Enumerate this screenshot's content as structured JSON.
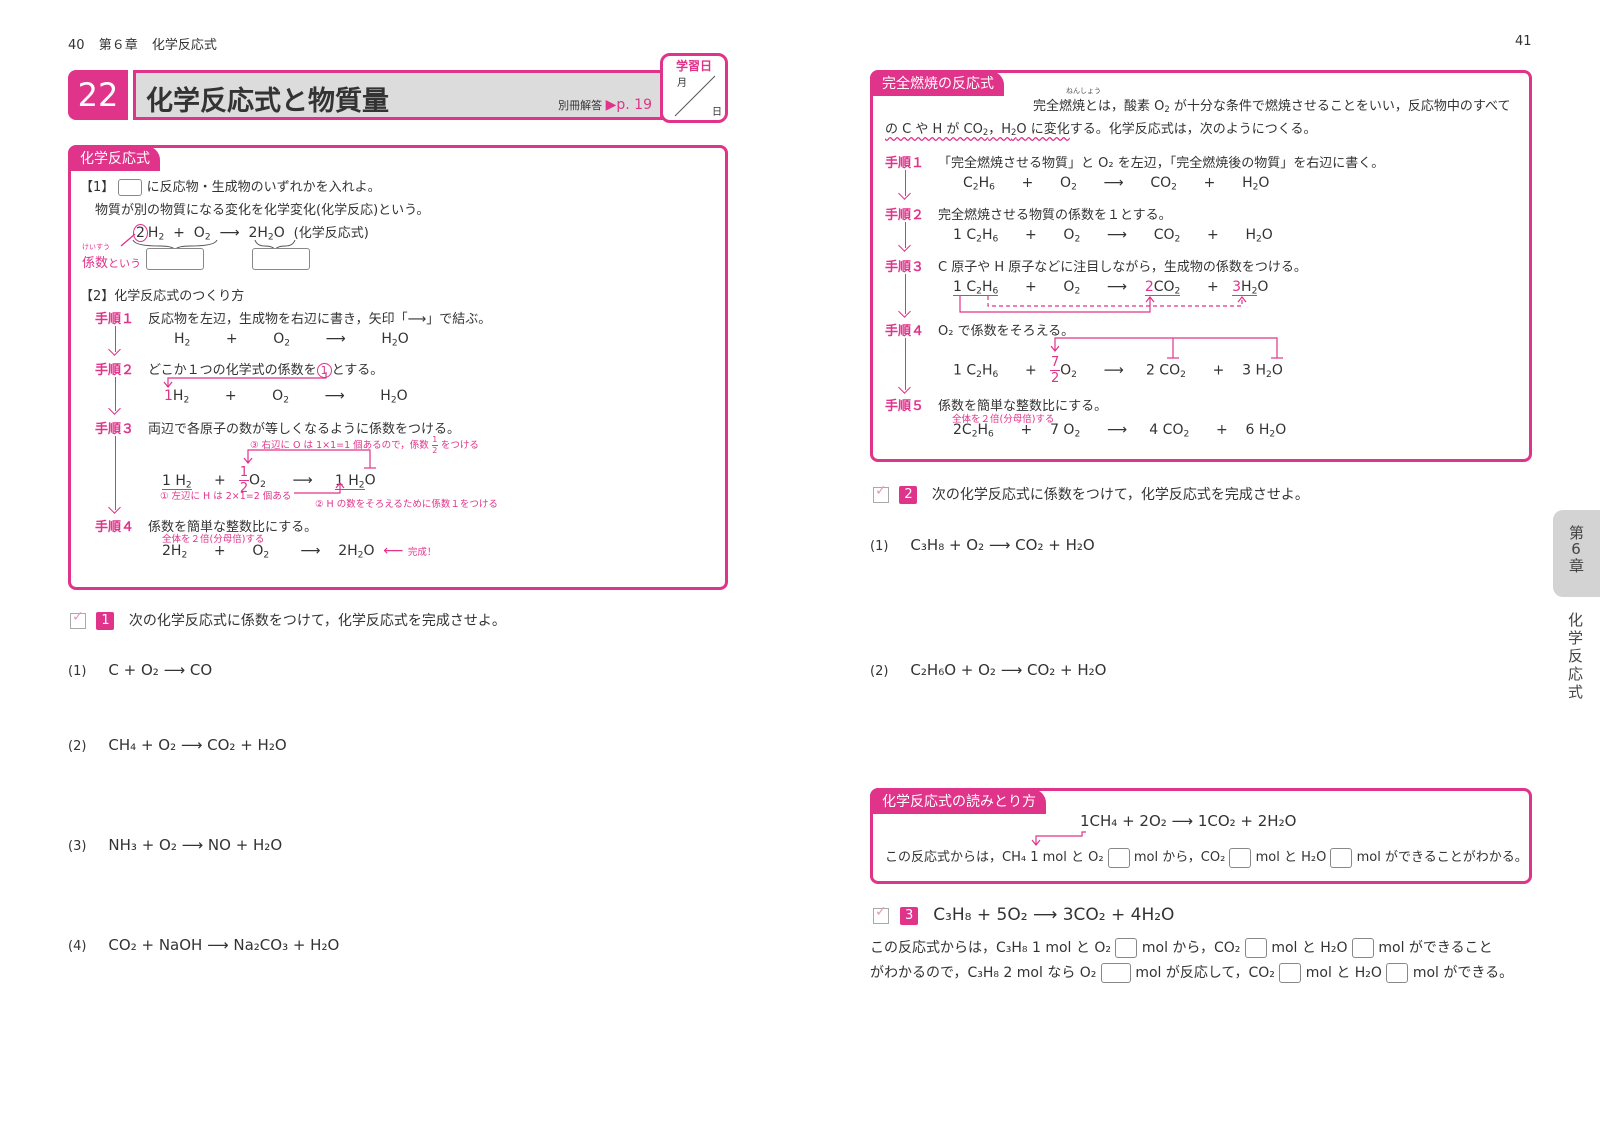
{
  "left_page": {
    "running_head": {
      "page_number": "40",
      "chapter": "第６章",
      "chapter_title": "化学反応式"
    },
    "lesson": {
      "number": "22",
      "title": "化学反応式と物質量",
      "answer_ref_label": "別冊解答",
      "answer_ref_page": "p. 19",
      "study_date": {
        "label": "学習日",
        "month": "月",
        "day": "日"
      }
    },
    "box": {
      "tag": "化学反応式",
      "q1": {
        "label": "【1】",
        "instruction": "に反応物・生成物のいずれかを入れよ。",
        "definition": "物質が別の物質になる変化を化学変化(化学反応)という。",
        "equation_note": "(化学反応式)",
        "coefficient_ruby": "けいすう",
        "coefficient_label": "係数",
        "coefficient_suffix": "という"
      },
      "q2": {
        "label": "【2】化学反応式のつくり方",
        "steps": [
          {
            "label": "手順１",
            "text": "反応物を左辺，生成物を右辺に書き，矢印「⟶」で結ぶ。"
          },
          {
            "label": "手順２",
            "text_pre": "どこか１つの化学式の係数を",
            "circled": "1",
            "text_post": "とする。"
          },
          {
            "label": "手順３",
            "text": "両辺で各原子の数が等しくなるように係数をつける。",
            "note3": "③ 右辺に O は 1×1=1 個あるので，係数",
            "note3_frac": {
              "num": "1",
              "den": "2"
            },
            "note3_post": "をつける",
            "note1": "① 左辺に H は 2×1=2 個ある",
            "note2": "② H の数をそろえるために係数１をつける"
          },
          {
            "label": "手順４",
            "text": "係数を簡単な整数比にする。",
            "note": "全体を２倍(分母倍)する",
            "done": "完成！"
          }
        ]
      }
    },
    "exercise1": {
      "number": "1",
      "instruction": "次の化学反応式に係数をつけて，化学反応式を完成させよ。",
      "items": [
        {
          "label": "(1)",
          "equation": "C + O₂ ⟶ CO"
        },
        {
          "label": "(2)",
          "equation": "CH₄ + O₂ ⟶ CO₂ + H₂O"
        },
        {
          "label": "(3)",
          "equation": "NH₃ + O₂ ⟶ NO + H₂O"
        },
        {
          "label": "(4)",
          "equation": "CO₂ + NaOH ⟶ Na₂CO₃ + H₂O"
        }
      ]
    }
  },
  "right_page": {
    "running_head": {
      "page_number": "41"
    },
    "combustion_box": {
      "tag": "完全燃焼の反応式",
      "ruby": "ねんしょう",
      "intro_line1_a": "完全燃焼とは，酸素 O",
      "intro_line1_b": "が十分な条件で燃焼させることをいい，反応物中のすべて",
      "intro_line2_a": "の C や H が CO",
      "intro_line2_b": "，H",
      "intro_line2_c": "O に変化",
      "intro_line2_d": "する。化学反応式は，次のようにつくる。",
      "steps": [
        {
          "label": "手順１",
          "text": "「完全燃焼させる物質」と O₂ を左辺，「完全燃焼後の物質」を右辺に書く。"
        },
        {
          "label": "手順２",
          "text": "完全燃焼させる物質の係数を１とする。"
        },
        {
          "label": "手順３",
          "text": "C 原子や H 原子などに注目しながら，生成物の係数をつける。"
        },
        {
          "label": "手順４",
          "text": "O₂ で係数をそろえる。",
          "frac": {
            "num": "7",
            "den": "2"
          }
        },
        {
          "label": "手順５",
          "text": "係数を簡単な整数比にする。",
          "note": "全体を２倍(分母倍)する"
        }
      ],
      "coef": {
        "s2": "1",
        "s3_a": "1",
        "s3_b": "2",
        "s3_c": "3",
        "s4_a": "1",
        "s4_b": "2",
        "s4_c": "3",
        "s5_a": "2",
        "s5_b": "7",
        "s5_c": "4",
        "s5_d": "6"
      }
    },
    "exercise2": {
      "number": "2",
      "instruction": "次の化学反応式に係数をつけて，化学反応式を完成させよ。",
      "items": [
        {
          "label": "(1)",
          "equation": "C₃H₈ + O₂ ⟶ CO₂ + H₂O"
        },
        {
          "label": "(2)",
          "equation": "C₂H₆O + O₂ ⟶ CO₂ + H₂O"
        }
      ]
    },
    "reading_box": {
      "tag": "化学反応式の読みとり方",
      "equation": "1CH₄ + 2O₂ ⟶ 1CO₂ + 2H₂O",
      "sentence_a": "この反応式からは，CH₄ 1 mol と O₂",
      "sentence_b": "mol から，CO₂",
      "sentence_c": "mol と H₂O",
      "sentence_d": "mol ができることがわかる。"
    },
    "exercise3": {
      "number": "3",
      "equation": "C₃H₈ + 5O₂ ⟶ 3CO₂ + 4H₂O",
      "line1_a": "この反応式からは，C₃H₈ 1 mol と O₂",
      "line1_b": "mol から，CO₂",
      "line1_c": "mol と H₂O",
      "line1_d": "mol ができること",
      "line2_a": "がわかるので，C₃H₈ 2 mol なら O₂",
      "line2_b": "mol が反応して，CO₂",
      "line2_c": "mol と H₂O",
      "line2_d": "mol ができる。"
    },
    "side_tab": {
      "chapter": "第6章",
      "title": "化学反応式"
    }
  }
}
